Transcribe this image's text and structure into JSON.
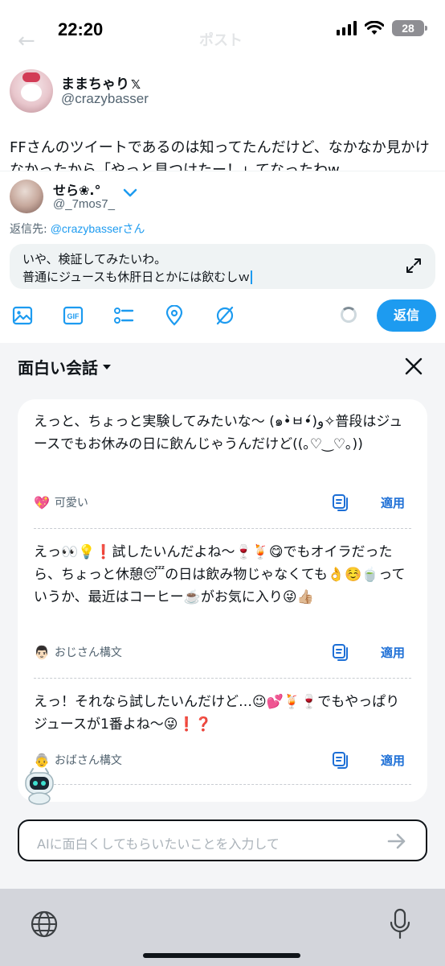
{
  "status_bar": {
    "time": "22:20",
    "battery": "28"
  },
  "header_ghost": {
    "title": "ポスト",
    "back": "←"
  },
  "original_post": {
    "display_name": "ままちゃり",
    "verified_mark": "𝕏",
    "handle": "@crazybasser",
    "text": "FFさんのツイートであるのは知ってたんだけど、なかなか見かけなかったから「やっと見つけたー！」てなったわw"
  },
  "reply": {
    "display_name": "せら❀.°",
    "handle": "@_7mos7_",
    "replying_to_label": "返信先:",
    "replying_to_mention": "@crazybasser",
    "replying_to_suffix": "さん",
    "line1": "いや、検証してみたいわ。",
    "line2": "普通にジュースも休肝日とかには飲むしｗ",
    "reply_button": "返信"
  },
  "ai_panel": {
    "title": "面白い会話",
    "suggestions": [
      {
        "text": "えっと、ちょっと実験してみたいな〜 (๑•̀ㅂ•́)و✧普段はジュースでもお休みの日に飲んじゃうんだけど((｡♡‿♡｡))",
        "tag_icon": "💖",
        "tag": "可愛い",
        "apply": "適用"
      },
      {
        "text": "えっ👀💡❗️試したいんだよね〜🍷🍹😋でもオイラだったら、ちょっと休憩😴の日は飲み物じゃなくても👌☺️🍵っていうか、最近はコーヒー☕️がお気に入り😜👍🏼",
        "tag_icon": "👨🏻",
        "tag": "おじさん構文",
        "apply": "適用"
      },
      {
        "text": "えっ！それなら試したいんだけど…😉💕🍹🍷でもやっぱりジュースが1番よね〜😜❗️❓",
        "tag_icon": "👵",
        "tag": "おばさん構文",
        "apply": "適用"
      }
    ],
    "input_placeholder": "AIに面白くしてもらいたいことを入力して"
  }
}
